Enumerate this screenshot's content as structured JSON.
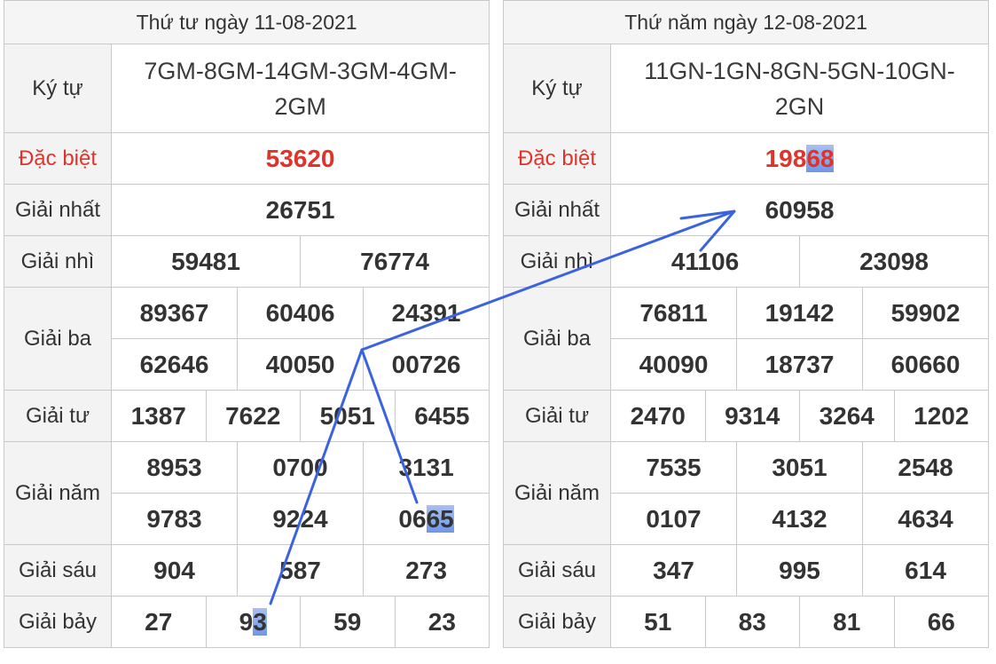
{
  "left": {
    "header": "Thứ tư ngày 11-08-2021",
    "labels": {
      "kytu": "Ký tự",
      "db": "Đặc biệt",
      "g1": "Giải nhất",
      "g2": "Giải nhì",
      "g3": "Giải ba",
      "g4": "Giải tư",
      "g5": "Giải năm",
      "g6": "Giải sáu",
      "g7": "Giải bảy"
    },
    "kytu": [
      "7GM-8GM-14GM-3GM-4GM-",
      "2GM"
    ],
    "db": "53620",
    "g1": "26751",
    "g2": [
      "59481",
      "76774"
    ],
    "g3": [
      "89367",
      "60406",
      "24391",
      "62646",
      "40050",
      "00726"
    ],
    "g4": [
      "1387",
      "7622",
      "5051",
      "6455"
    ],
    "g5": [
      "8953",
      "0700",
      "3131",
      "9783",
      "9224",
      "0665"
    ],
    "g5_split": [
      "06",
      "65"
    ],
    "g6": [
      "904",
      "587",
      "273"
    ],
    "g7": [
      "27",
      "93",
      "59",
      "23"
    ],
    "g7_split": [
      "9",
      "3"
    ]
  },
  "right": {
    "header": "Thứ năm ngày 12-08-2021",
    "labels": {
      "kytu": "Ký tự",
      "db": "Đặc biệt",
      "g1": "Giải nhất",
      "g2": "Giải nhì",
      "g3": "Giải ba",
      "g4": "Giải tư",
      "g5": "Giải năm",
      "g6": "Giải sáu",
      "g7": "Giải bảy"
    },
    "kytu": [
      "11GN-1GN-8GN-5GN-10GN-",
      "2GN"
    ],
    "db": "19868",
    "db_split": [
      "198",
      "68"
    ],
    "g1": "60958",
    "g2": [
      "41106",
      "23098"
    ],
    "g3": [
      "76811",
      "19142",
      "59902",
      "40090",
      "18737",
      "60660"
    ],
    "g4": [
      "2470",
      "9314",
      "3264",
      "1202"
    ],
    "g5": [
      "7535",
      "3051",
      "2548",
      "0107",
      "4132",
      "4634"
    ],
    "g6": [
      "347",
      "995",
      "614"
    ],
    "g7": [
      "51",
      "83",
      "81",
      "66"
    ]
  },
  "colors": {
    "special": "#e0342b",
    "highlight": "#7a9ef0",
    "arrow": "#3a63e0"
  }
}
